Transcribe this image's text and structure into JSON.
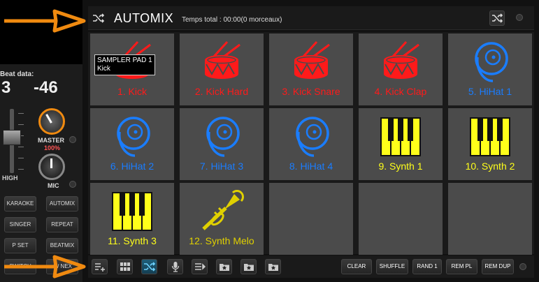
{
  "left_panel": {
    "beat_label": "Beat data:",
    "beat_value_1": "3",
    "beat_value_2": "-46",
    "high_label": "HIGH",
    "master_label": "MASTER",
    "master_percent": "100%",
    "mic_label": "MIC",
    "buttons": [
      "KARAOKE",
      "AUTOMIX",
      "SINGER",
      "REPEAT",
      "P SET",
      "BEATMIX",
      "SWITCH",
      "A / NEX"
    ]
  },
  "header": {
    "title": "AUTOMIX",
    "subtitle": "Temps total : 00:00(0 morceaux)",
    "shuffle_icon": "shuffle-icon"
  },
  "tooltip": {
    "line1": "SAMPLER PAD 1",
    "line2": "Kick"
  },
  "pads": [
    {
      "label": "1. Kick",
      "icon": "drum-icon",
      "color": "#ff1a1a"
    },
    {
      "label": "2. Kick Hard",
      "icon": "drum-icon",
      "color": "#ff1a1a"
    },
    {
      "label": "3. Kick Snare",
      "icon": "drum-icon",
      "color": "#ff1a1a"
    },
    {
      "label": "4. Kick Clap",
      "icon": "drum-icon",
      "color": "#ff1a1a"
    },
    {
      "label": "5. HiHat 1",
      "icon": "cymbal-icon",
      "color": "#1a7dff"
    },
    {
      "label": "6. HiHat 2",
      "icon": "cymbal-icon",
      "color": "#1a7dff"
    },
    {
      "label": "7. HiHat 3",
      "icon": "cymbal-icon",
      "color": "#1a7dff"
    },
    {
      "label": "8. HiHat 4",
      "icon": "cymbal-icon",
      "color": "#1a7dff"
    },
    {
      "label": "9. Synth 1",
      "icon": "keyboard-icon",
      "color": "#ffff1a"
    },
    {
      "label": "10. Synth 2",
      "icon": "keyboard-icon",
      "color": "#ffff1a"
    },
    {
      "label": "11. Synth 3",
      "icon": "keyboard-icon",
      "color": "#ffff1a"
    },
    {
      "label": "12. Synth Melo",
      "icon": "trumpet-icon",
      "color": "#e0d000"
    },
    {
      "label": "",
      "icon": "",
      "color": ""
    },
    {
      "label": "",
      "icon": "",
      "color": ""
    },
    {
      "label": "",
      "icon": "",
      "color": ""
    }
  ],
  "toolbar": {
    "icon_buttons": [
      "playlist-add-icon",
      "grid-icon",
      "shuffle-icon",
      "mic-icon",
      "playlist-icon",
      "star-folder-icon",
      "star-folder-icon",
      "star-folder-icon"
    ],
    "text_buttons": [
      "CLEAR",
      "SHUFFLE",
      "RAND 1",
      "REM PL",
      "REM DUP"
    ]
  },
  "colors": {
    "accent": "#f08a10",
    "arrow": "#f08a10"
  }
}
